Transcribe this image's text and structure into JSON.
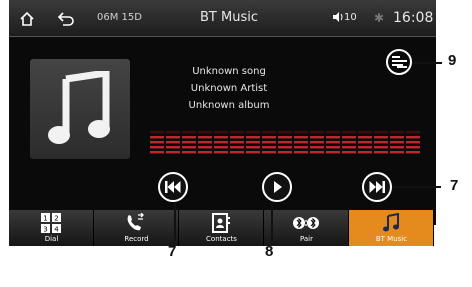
{
  "status_bar": {
    "date": "06M 15D",
    "title": "BT Music",
    "volume": "10",
    "clock": "16:08"
  },
  "track": {
    "song": "Unknown song",
    "artist": "Unknown Artist",
    "album": "Unknown album"
  },
  "tabs": [
    {
      "label": "Dial",
      "icon": "dialpad-icon"
    },
    {
      "label": "Record",
      "icon": "call-log-icon"
    },
    {
      "label": "Contacts",
      "icon": "contacts-icon"
    },
    {
      "label": "Pair",
      "icon": "bluetooth-pair-icon"
    },
    {
      "label": "BT Music",
      "icon": "music-note-icon"
    }
  ],
  "callouts": {
    "eq": "9",
    "next": "7",
    "prev": "7",
    "play": "8"
  },
  "colors": {
    "accent": "#e58a1c",
    "equalizer": "#c8232c"
  }
}
